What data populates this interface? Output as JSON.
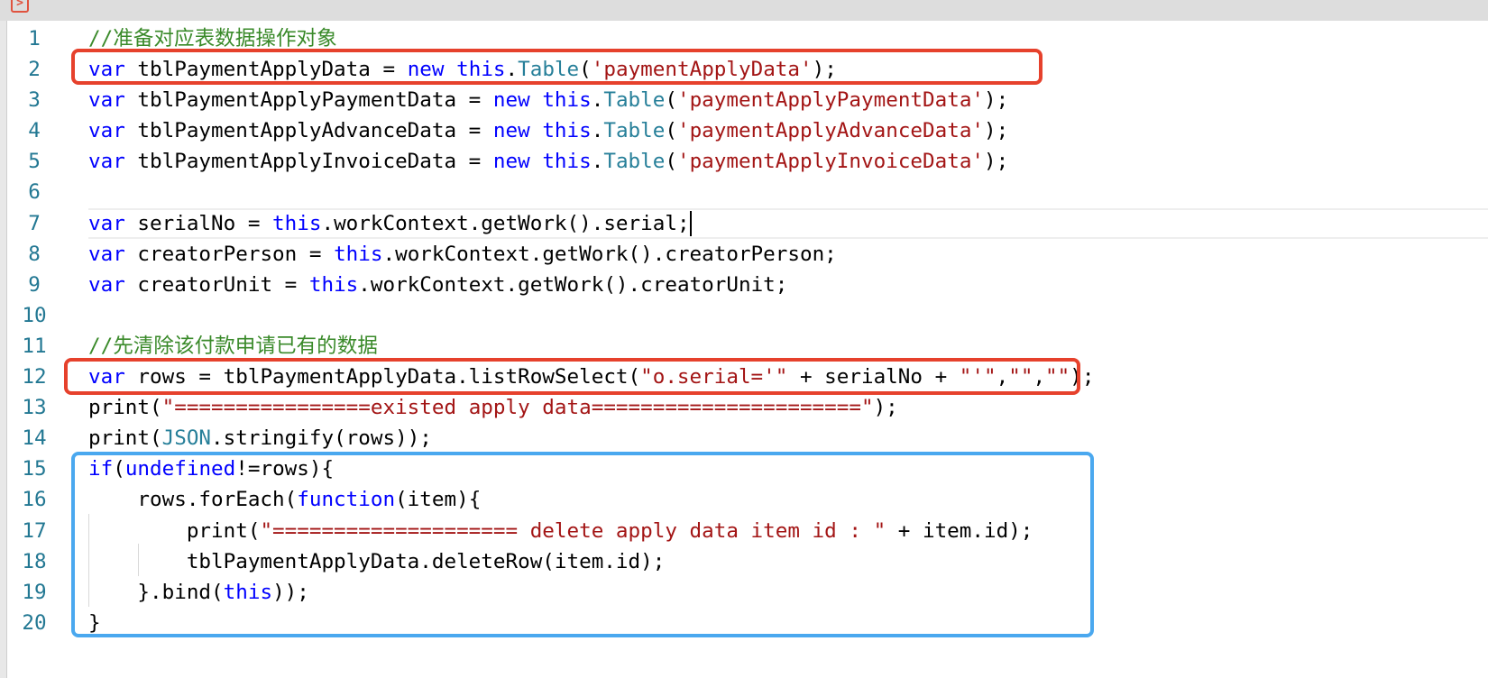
{
  "toolbar": {
    "run_icon": "run-panel-icon"
  },
  "colors": {
    "keyword": "#0000ff",
    "string": "#a31515",
    "comment": "#3a8a2a",
    "type": "#267f99",
    "line_number": "#237893",
    "highlight_red": "#e6412c",
    "highlight_blue": "#4aa8ef"
  },
  "editor": {
    "active_line": 7,
    "lines": [
      {
        "n": "1",
        "tokens": [
          {
            "c": "cm",
            "t": "//准备对应表数据操作对象"
          }
        ]
      },
      {
        "n": "2",
        "tokens": [
          {
            "c": "kw",
            "t": "var"
          },
          {
            "c": "pl",
            "t": " tblPaymentApplyData = "
          },
          {
            "c": "kw",
            "t": "new"
          },
          {
            "c": "pl",
            "t": " "
          },
          {
            "c": "kw",
            "t": "this"
          },
          {
            "c": "pl",
            "t": "."
          },
          {
            "c": "ty",
            "t": "Table"
          },
          {
            "c": "pl",
            "t": "("
          },
          {
            "c": "str",
            "t": "'paymentApplyData'"
          },
          {
            "c": "pl",
            "t": ");"
          }
        ]
      },
      {
        "n": "3",
        "tokens": [
          {
            "c": "kw",
            "t": "var"
          },
          {
            "c": "pl",
            "t": " tblPaymentApplyPaymentData = "
          },
          {
            "c": "kw",
            "t": "new"
          },
          {
            "c": "pl",
            "t": " "
          },
          {
            "c": "kw",
            "t": "this"
          },
          {
            "c": "pl",
            "t": "."
          },
          {
            "c": "ty",
            "t": "Table"
          },
          {
            "c": "pl",
            "t": "("
          },
          {
            "c": "str",
            "t": "'paymentApplyPaymentData'"
          },
          {
            "c": "pl",
            "t": ");"
          }
        ]
      },
      {
        "n": "4",
        "tokens": [
          {
            "c": "kw",
            "t": "var"
          },
          {
            "c": "pl",
            "t": " tblPaymentApplyAdvanceData = "
          },
          {
            "c": "kw",
            "t": "new"
          },
          {
            "c": "pl",
            "t": " "
          },
          {
            "c": "kw",
            "t": "this"
          },
          {
            "c": "pl",
            "t": "."
          },
          {
            "c": "ty",
            "t": "Table"
          },
          {
            "c": "pl",
            "t": "("
          },
          {
            "c": "str",
            "t": "'paymentApplyAdvanceData'"
          },
          {
            "c": "pl",
            "t": ");"
          }
        ]
      },
      {
        "n": "5",
        "tokens": [
          {
            "c": "kw",
            "t": "var"
          },
          {
            "c": "pl",
            "t": " tblPaymentApplyInvoiceData = "
          },
          {
            "c": "kw",
            "t": "new"
          },
          {
            "c": "pl",
            "t": " "
          },
          {
            "c": "kw",
            "t": "this"
          },
          {
            "c": "pl",
            "t": "."
          },
          {
            "c": "ty",
            "t": "Table"
          },
          {
            "c": "pl",
            "t": "("
          },
          {
            "c": "str",
            "t": "'paymentApplyInvoiceData'"
          },
          {
            "c": "pl",
            "t": ");"
          }
        ]
      },
      {
        "n": "6",
        "tokens": []
      },
      {
        "n": "7",
        "tokens": [
          {
            "c": "kw",
            "t": "var"
          },
          {
            "c": "pl",
            "t": " serialNo = "
          },
          {
            "c": "kw",
            "t": "this"
          },
          {
            "c": "pl",
            "t": ".workContext.getWork().serial;"
          }
        ]
      },
      {
        "n": "8",
        "tokens": [
          {
            "c": "kw",
            "t": "var"
          },
          {
            "c": "pl",
            "t": " creatorPerson = "
          },
          {
            "c": "kw",
            "t": "this"
          },
          {
            "c": "pl",
            "t": ".workContext.getWork().creatorPerson;"
          }
        ]
      },
      {
        "n": "9",
        "tokens": [
          {
            "c": "kw",
            "t": "var"
          },
          {
            "c": "pl",
            "t": " creatorUnit = "
          },
          {
            "c": "kw",
            "t": "this"
          },
          {
            "c": "pl",
            "t": ".workContext.getWork().creatorUnit;"
          }
        ]
      },
      {
        "n": "10",
        "tokens": []
      },
      {
        "n": "11",
        "tokens": [
          {
            "c": "cm",
            "t": "//先清除该付款申请已有的数据"
          }
        ]
      },
      {
        "n": "12",
        "tokens": [
          {
            "c": "kw",
            "t": "var"
          },
          {
            "c": "pl",
            "t": " rows = tblPaymentApplyData.listRowSelect("
          },
          {
            "c": "str",
            "t": "\"o.serial='\""
          },
          {
            "c": "pl",
            "t": " + serialNo + "
          },
          {
            "c": "str",
            "t": "\"'\""
          },
          {
            "c": "pl",
            "t": ","
          },
          {
            "c": "str",
            "t": "\"\""
          },
          {
            "c": "pl",
            "t": ","
          },
          {
            "c": "str",
            "t": "\"\""
          },
          {
            "c": "pl",
            "t": ");"
          }
        ]
      },
      {
        "n": "13",
        "tokens": [
          {
            "c": "pl",
            "t": "print("
          },
          {
            "c": "str",
            "t": "\"================existed apply data======================\""
          },
          {
            "c": "pl",
            "t": ");"
          }
        ]
      },
      {
        "n": "14",
        "tokens": [
          {
            "c": "pl",
            "t": "print("
          },
          {
            "c": "ty",
            "t": "JSON"
          },
          {
            "c": "pl",
            "t": ".stringify(rows));"
          }
        ]
      },
      {
        "n": "15",
        "tokens": [
          {
            "c": "kw",
            "t": "if"
          },
          {
            "c": "pl",
            "t": "("
          },
          {
            "c": "kw",
            "t": "undefined"
          },
          {
            "c": "pl",
            "t": "!=rows){"
          }
        ]
      },
      {
        "n": "16",
        "tokens": [
          {
            "c": "pl",
            "t": "    rows.forEach("
          },
          {
            "c": "kw",
            "t": "function"
          },
          {
            "c": "pl",
            "t": "(item){"
          }
        ]
      },
      {
        "n": "17",
        "tokens": [
          {
            "c": "pl",
            "t": "        print("
          },
          {
            "c": "str",
            "t": "\"==================== delete apply data item id : \""
          },
          {
            "c": "pl",
            "t": " + item.id);"
          }
        ]
      },
      {
        "n": "18",
        "tokens": [
          {
            "c": "pl",
            "t": "        tblPaymentApplyData.deleteRow(item.id);"
          }
        ]
      },
      {
        "n": "19",
        "tokens": [
          {
            "c": "pl",
            "t": "    }.bind("
          },
          {
            "c": "kw",
            "t": "this"
          },
          {
            "c": "pl",
            "t": "));"
          }
        ]
      },
      {
        "n": "20",
        "tokens": [
          {
            "c": "pl",
            "t": "}"
          }
        ]
      }
    ]
  }
}
